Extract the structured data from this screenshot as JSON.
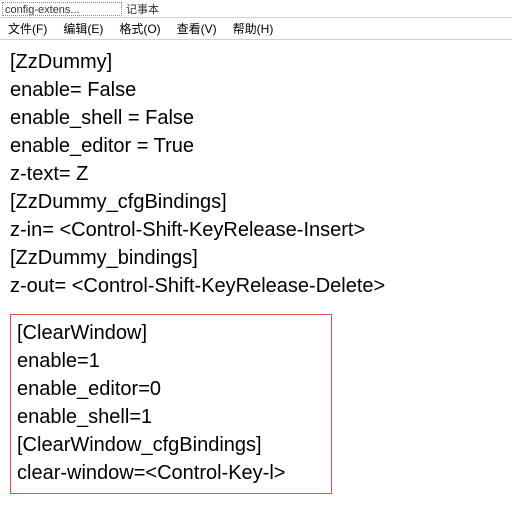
{
  "titlebar": {
    "filename_partial": "config-extens...",
    "suffix": "记事本"
  },
  "menu": {
    "file": "文件(F)",
    "edit": "编辑(E)",
    "format": "格式(O)",
    "view": "查看(V)",
    "help": "帮助(H)"
  },
  "block1": {
    "l0": "[ZzDummy]",
    "l1": "enable= False",
    "l2": "enable_shell = False",
    "l3": "enable_editor = True",
    "l4": "z-text= Z",
    "l5": "[ZzDummy_cfgBindings]",
    "l6": "z-in= <Control-Shift-KeyRelease-Insert>",
    "l7": "[ZzDummy_bindings]",
    "l8": "z-out= <Control-Shift-KeyRelease-Delete>"
  },
  "block2": {
    "l0": "[ClearWindow]",
    "l1": "enable=1",
    "l2": "enable_editor=0",
    "l3": "enable_shell=1",
    "l4": "[ClearWindow_cfgBindings]",
    "l5": "clear-window=<Control-Key-l>"
  }
}
